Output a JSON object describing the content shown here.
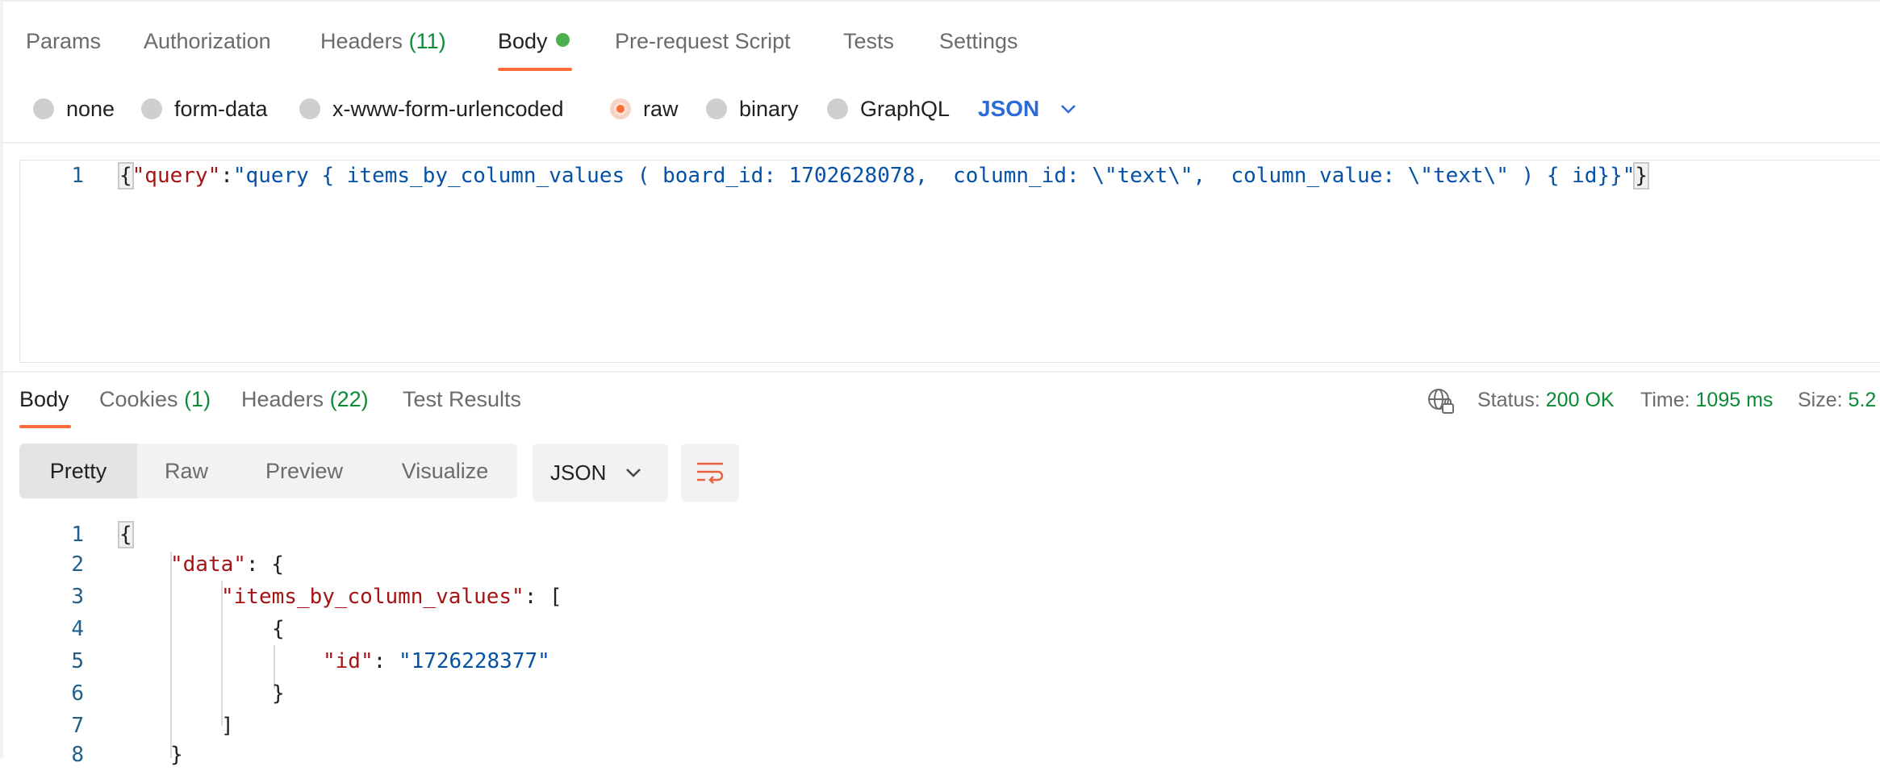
{
  "request_tabs": [
    {
      "label": "Params"
    },
    {
      "label": "Authorization"
    },
    {
      "label": "Headers",
      "count": "(11)"
    },
    {
      "label": "Body",
      "active": true
    },
    {
      "label": "Pre-request Script"
    },
    {
      "label": "Tests"
    },
    {
      "label": "Settings"
    }
  ],
  "body_types": [
    {
      "label": "none"
    },
    {
      "label": "form-data"
    },
    {
      "label": "x-www-form-urlencoded"
    },
    {
      "label": "raw",
      "selected": true
    },
    {
      "label": "binary"
    },
    {
      "label": "GraphQL"
    }
  ],
  "body_format": "JSON",
  "request_editor": {
    "line_number": "1",
    "open": "{",
    "key": "\"query\"",
    "colon": ":",
    "value": "\"query { items_by_column_values ( board_id: 1702628078,  column_id: \\\"text\\\",  column_value: \\\"text\\\" ) { id}}\"",
    "close": "}"
  },
  "response_tabs": [
    {
      "label": "Body",
      "active": true
    },
    {
      "label": "Cookies",
      "count": "(1)"
    },
    {
      "label": "Headers",
      "count": "(22)"
    },
    {
      "label": "Test Results"
    }
  ],
  "status": {
    "status_label": "Status:",
    "status_value": "200 OK",
    "time_label": "Time:",
    "time_value": "1095 ms",
    "size_label": "Size:",
    "size_value": "5.2"
  },
  "view_modes": [
    "Pretty",
    "Raw",
    "Preview",
    "Visualize"
  ],
  "response_format": "JSON",
  "response_lines": [
    {
      "n": "1",
      "t1": "{"
    },
    {
      "n": "2",
      "k": "\"data\"",
      "t2": ": {"
    },
    {
      "n": "3",
      "k": "\"items_by_column_values\"",
      "t2": ": ["
    },
    {
      "n": "4",
      "t1": "{"
    },
    {
      "n": "5",
      "k": "\"id\"",
      "t2": ": ",
      "s": "\"1726228377\""
    },
    {
      "n": "6",
      "t1": "}"
    },
    {
      "n": "7",
      "t1": "]"
    },
    {
      "n": "8",
      "t1": "}"
    }
  ],
  "colors": {
    "accent": "#ff6c37",
    "success": "#0a8a35",
    "link": "#2c6bd6"
  }
}
